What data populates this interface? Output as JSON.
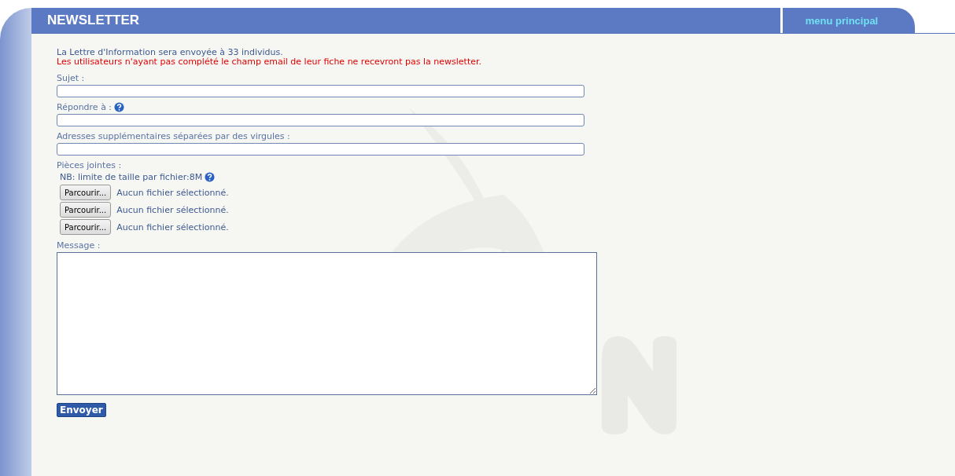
{
  "header": {
    "title": "NEWSLETTER",
    "tab": "menu principal"
  },
  "info": "La Lettre d'Information sera envoyée à 33 individus.",
  "warning": "Les utilisateurs n'ayant pas complété le champ email de leur fiche ne recevront pas la newsletter.",
  "fields": [
    {
      "label": "Sujet :",
      "help": false
    },
    {
      "label": "Répondre à :",
      "help": true
    },
    {
      "label": "Adresses supplémentaires séparées par des virgules :",
      "help": false
    }
  ],
  "attachments": {
    "label": "Pièces jointes :",
    "note": "NB: limite de taille par fichier:8M",
    "help": true,
    "files": [
      {
        "button": "Parcourir...",
        "status": "Aucun fichier sélectionné."
      },
      {
        "button": "Parcourir...",
        "status": "Aucun fichier sélectionné."
      },
      {
        "button": "Parcourir...",
        "status": "Aucun fichier sélectionné."
      }
    ]
  },
  "message": {
    "label": "Message :"
  },
  "submit": "Envoyer"
}
